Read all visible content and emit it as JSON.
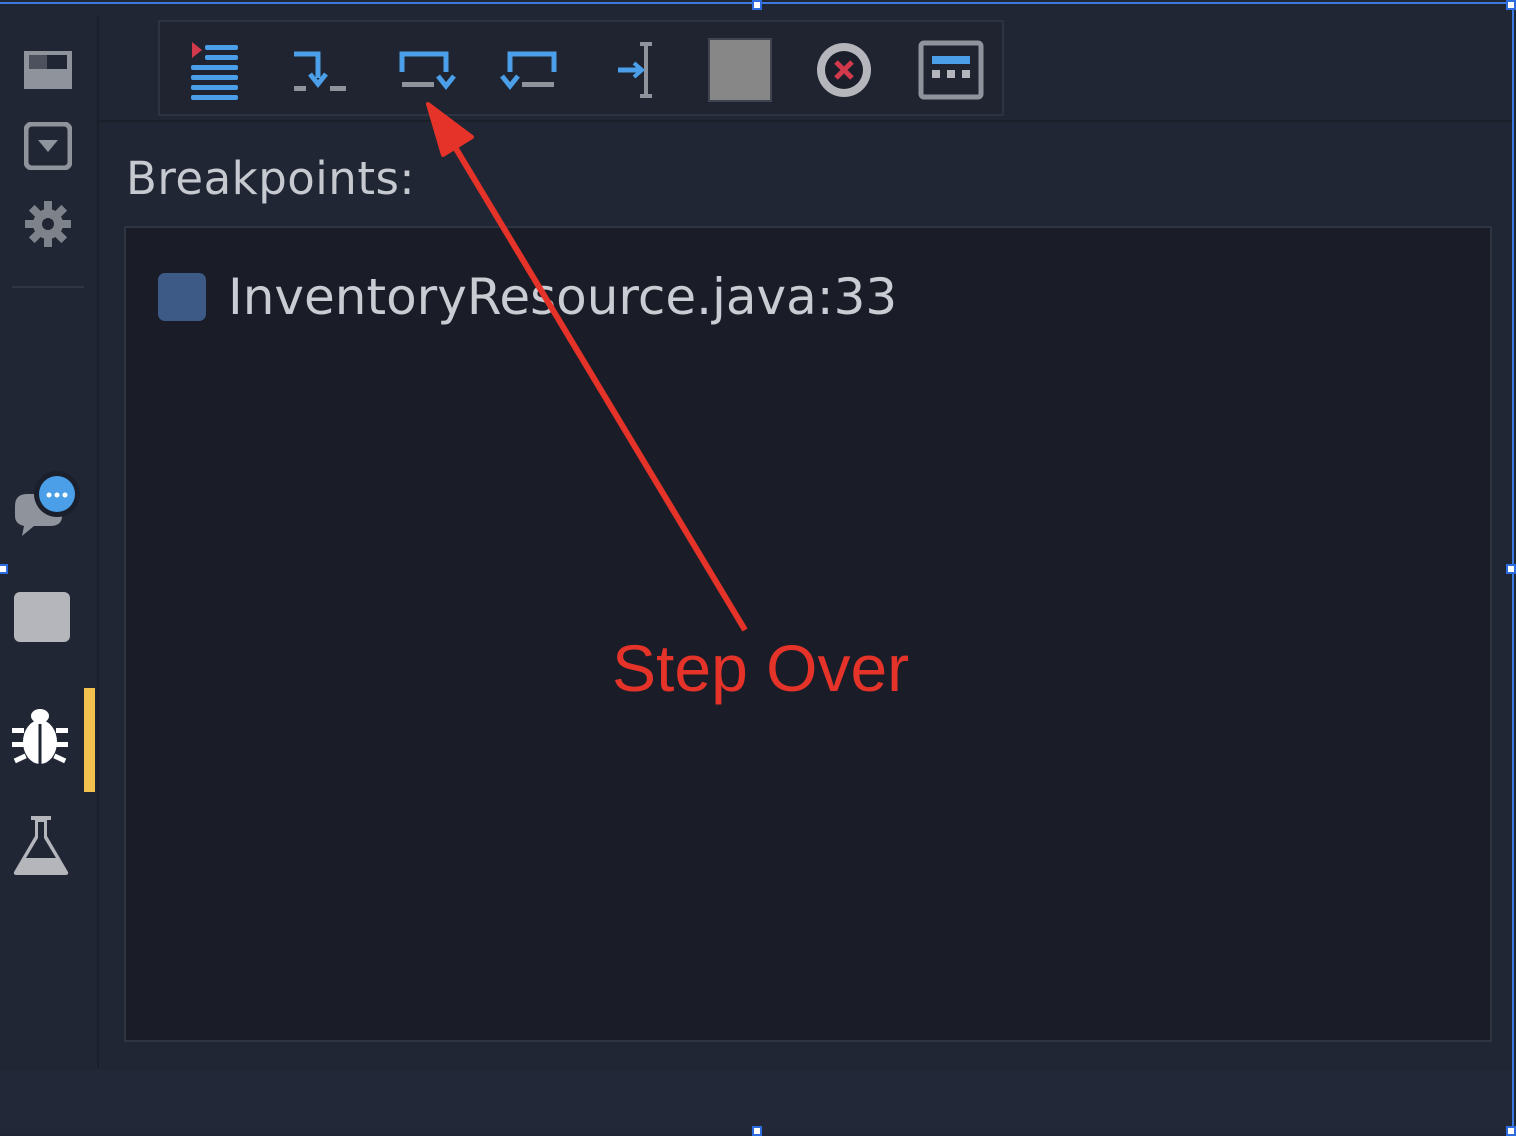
{
  "toolbar": {
    "buttons": [
      {
        "name": "continue-button",
        "icon": "continue-icon"
      },
      {
        "name": "step-into-button",
        "icon": "step-into-icon"
      },
      {
        "name": "step-over-button",
        "icon": "step-over-icon"
      },
      {
        "name": "step-out-button",
        "icon": "step-out-icon"
      },
      {
        "name": "run-to-cursor-button",
        "icon": "run-to-cursor-icon"
      },
      {
        "name": "stop-button",
        "icon": "stop-icon"
      },
      {
        "name": "remove-breakpoints-button",
        "icon": "close-circle-icon"
      },
      {
        "name": "panel-layout-button",
        "icon": "panel-icon"
      }
    ]
  },
  "sidebar": {
    "items": [
      {
        "icon": "window-icon"
      },
      {
        "icon": "dropdown-box-icon"
      },
      {
        "icon": "gear-icon"
      },
      {
        "icon": "chat-icon"
      },
      {
        "icon": "stop-square-icon"
      },
      {
        "icon": "bug-icon",
        "active": true
      },
      {
        "icon": "flask-icon"
      }
    ]
  },
  "breakpoints": {
    "label": "Breakpoints:",
    "items": [
      {
        "label": "InventoryResource.java:33"
      }
    ]
  },
  "annotation": {
    "text": "Step Over"
  },
  "colors": {
    "background": "#212634",
    "panel": "#1a1d27",
    "accent_blue": "#4a9fe8",
    "active_indicator": "#f2c14e",
    "annotation_red": "#e5332a"
  }
}
